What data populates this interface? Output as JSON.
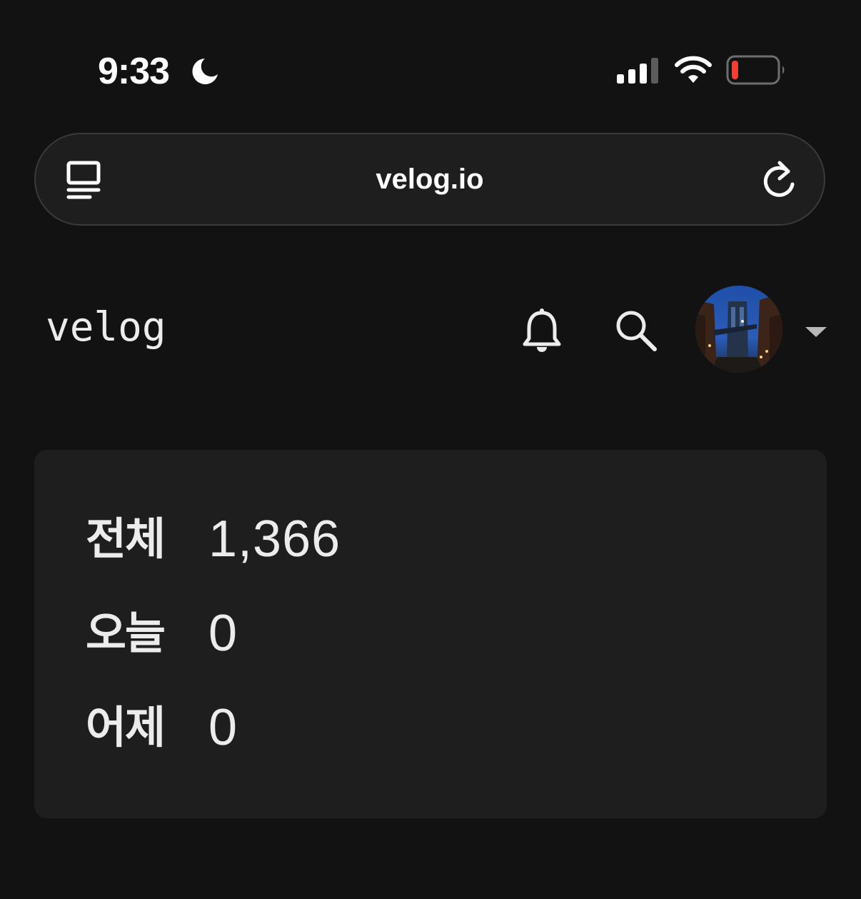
{
  "status_bar": {
    "time": "9:33",
    "icons": [
      "moon-icon",
      "signal-icon",
      "wifi-icon",
      "battery-icon"
    ],
    "battery_color": "#ff3b30"
  },
  "browser": {
    "url": "velog.io",
    "left_icon": "reader-icon",
    "right_icon": "reload-icon"
  },
  "header": {
    "logo": "velog",
    "icons": [
      "bell-icon",
      "search-icon",
      "avatar",
      "chevron-down-icon"
    ]
  },
  "stats": {
    "total": {
      "label": "전체",
      "value": "1,366"
    },
    "today": {
      "label": "오늘",
      "value": "0"
    },
    "yesterday": {
      "label": "어제",
      "value": "0"
    }
  },
  "colors": {
    "background": "#121212",
    "card": "#1e1e1e",
    "text": "#ececec"
  }
}
